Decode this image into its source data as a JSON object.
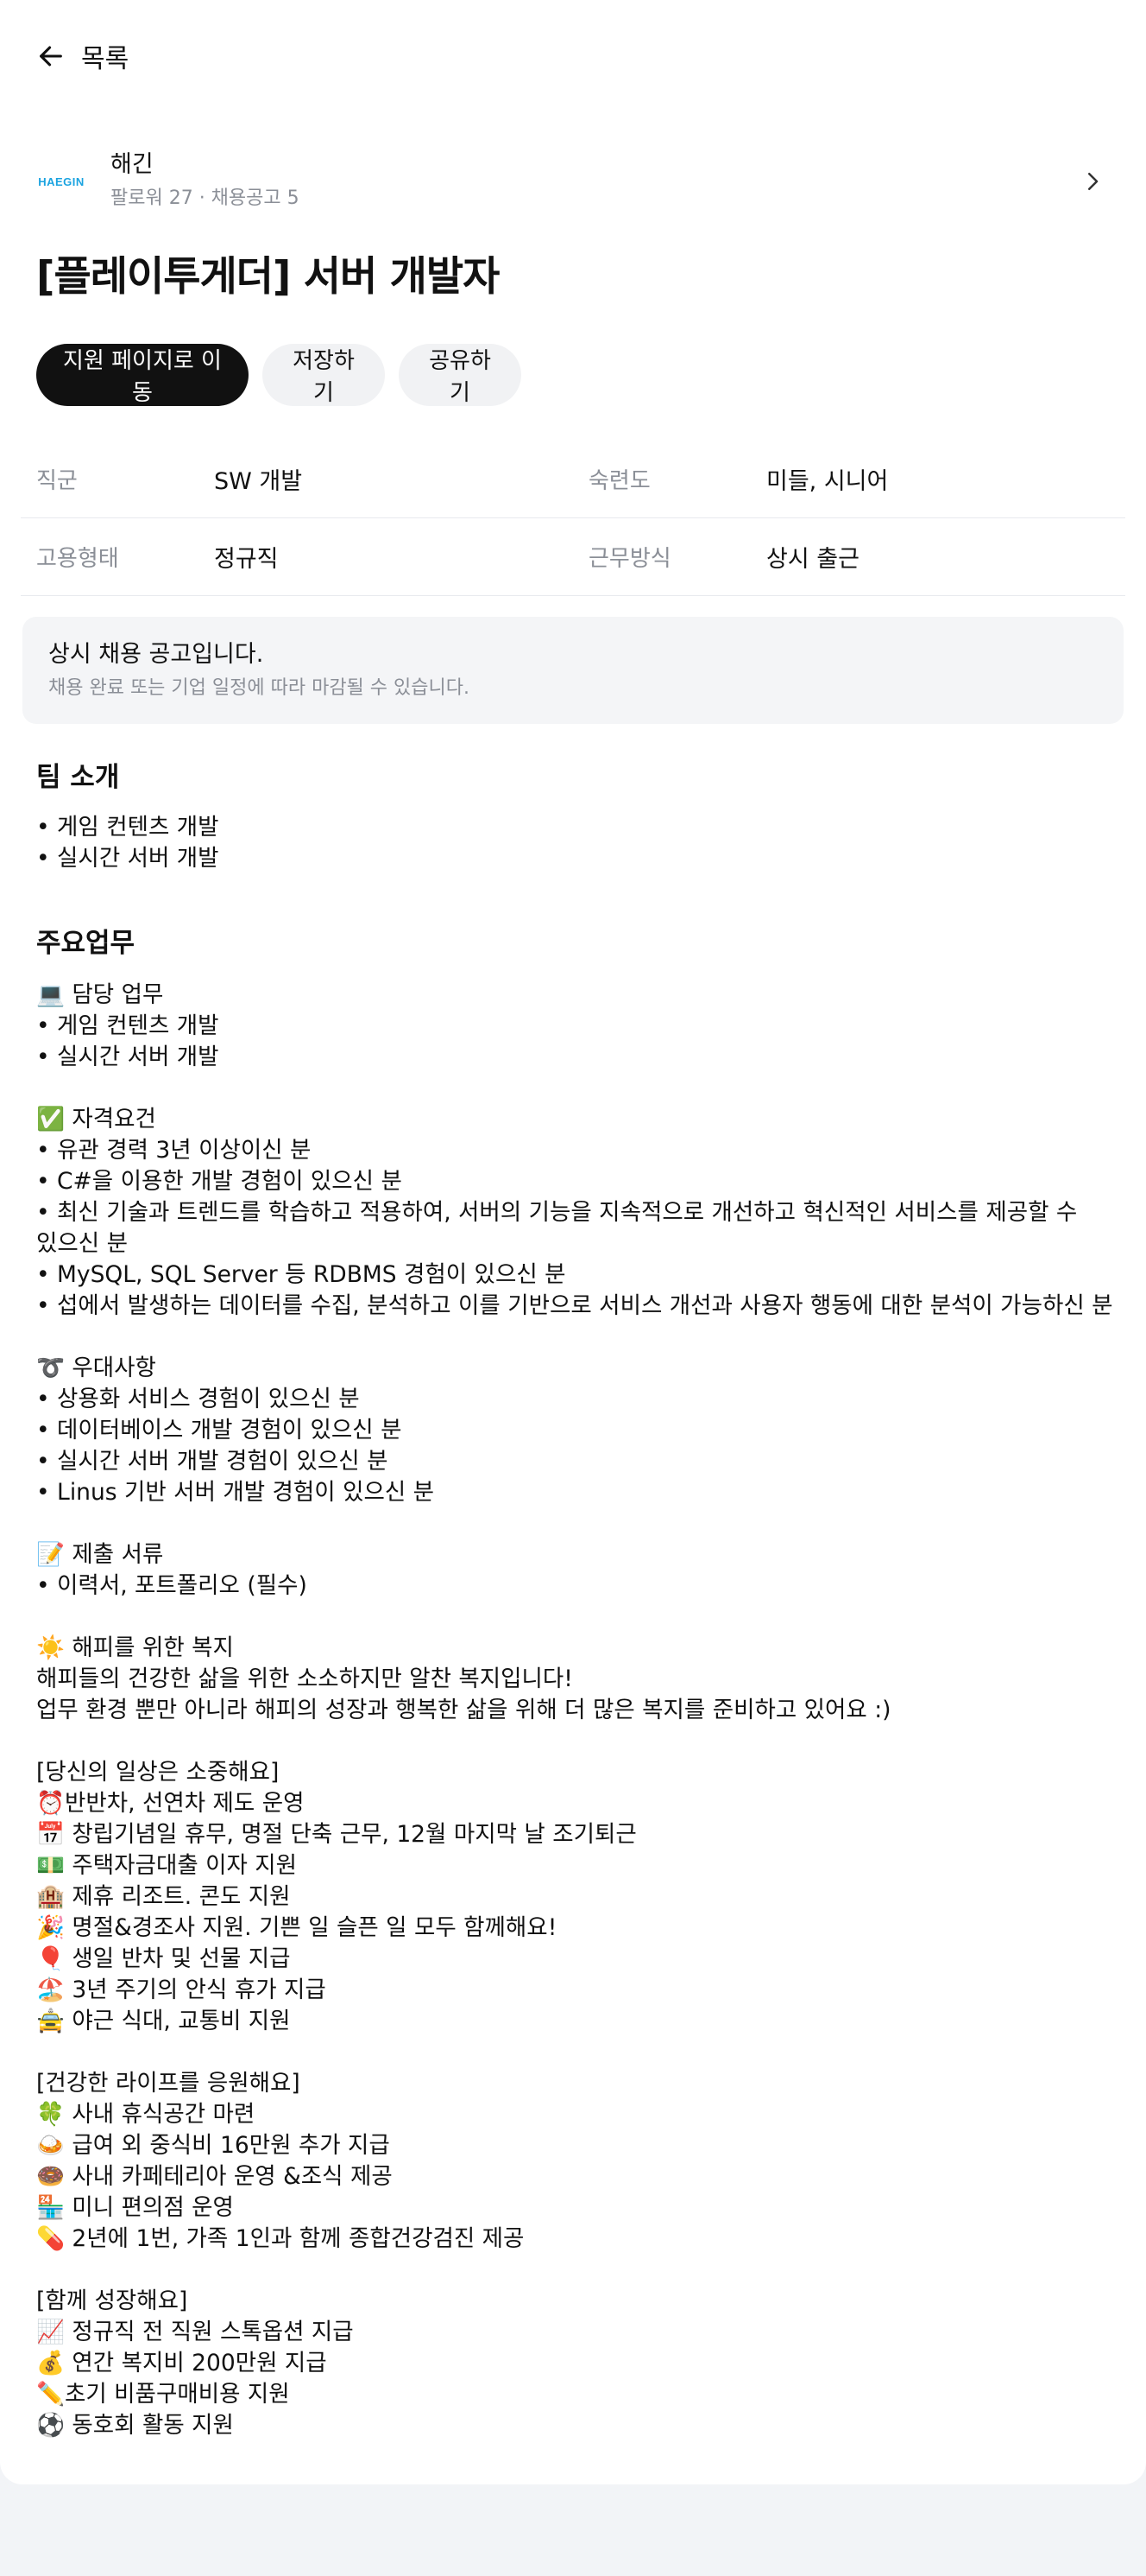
{
  "nav": {
    "back_label": "목록"
  },
  "company": {
    "logo_text": "HAEGIN",
    "name": "해긴",
    "meta": "팔로워 27 · 채용공고 5"
  },
  "job": {
    "title": "[플레이투게더] 서버 개발자"
  },
  "actions": {
    "apply": "지원 페이지로 이동",
    "save": "저장하기",
    "share": "공유하기"
  },
  "info": [
    {
      "label": "직군",
      "value": "SW 개발",
      "label2": "숙련도",
      "value2": "미들, 시니어"
    },
    {
      "label": "고용형태",
      "value": "정규직",
      "label2": "근무방식",
      "value2": "상시 출근"
    }
  ],
  "notice": {
    "title": "상시 채용 공고입니다.",
    "subtitle": "채용 완료 또는 기업 일정에 따라 마감될 수 있습니다."
  },
  "team": {
    "heading": "팀 소개",
    "lines": [
      "• 게임 컨텐츠 개발",
      "• 실시간 서버 개발"
    ]
  },
  "duties": {
    "heading": "주요업무",
    "lines": [
      "💻 담당 업무",
      "• 게임 컨텐츠 개발",
      "• 실시간 서버 개발",
      "",
      "✅ 자격요건",
      "• 유관 경력 3년 이상이신 분",
      "• C#을 이용한 개발 경험이 있으신 분",
      "• 최신 기술과 트렌드를 학습하고 적용하여, 서버의 기능을 지속적으로 개선하고 혁신적인 서비스를 제공할 수",
      "있으신 분",
      "• MySQL, SQL Server 등 RDBMS 경험이 있으신 분",
      "• 섭에서 발생하는 데이터를 수집, 분석하고 이를 기반으로 서비스 개선과 사용자 행동에 대한 분석이 가능하신 분",
      "",
      "➰ 우대사항",
      "• 상용화 서비스 경험이 있으신 분",
      "• 데이터베이스 개발 경험이 있으신 분",
      "• 실시간 서버 개발 경험이 있으신 분",
      "• Linus 기반 서버 개발 경험이 있으신 분",
      "",
      "📝 제출 서류",
      "• 이력서, 포트폴리오 (필수)",
      "",
      "☀️ 해피를 위한 복지",
      "해피들의 건강한 삶을 위한 소소하지만 알찬 복지입니다!",
      "업무 환경 뿐만 아니라 해피의 성장과 행복한 삶을 위해 더 많은 복지를 준비하고 있어요 :)",
      "",
      "[당신의 일상은 소중해요]",
      "⏰반반차, 선연차 제도 운영",
      "📅 창립기념일 휴무, 명절 단축 근무, 12월 마지막 날 조기퇴근",
      "💵 주택자금대출 이자 지원",
      "🏨 제휴 리조트. 콘도 지원",
      "🎉 명절&경조사 지원. 기쁜 일 슬픈 일 모두 함께해요!",
      "🎈 생일 반차 및 선물 지급",
      "🏖️ 3년 주기의 안식 휴가 지급",
      "🚖 야근 식대, 교통비 지원",
      "",
      "[건강한 라이프를 응원해요]",
      "🍀 사내 휴식공간 마련",
      "🍛 급여 외 중식비 16만원 추가 지급",
      "🍩 사내 카페테리아 운영 &조식 제공",
      "🏪 미니 편의점 운영",
      "💊 2년에 1번, 가족 1인과 함께 종합건강검진 제공",
      "",
      "[함께 성장해요]",
      "📈 정규직 전 직원 스톡옵션 지급",
      "💰 연간 복지비 200만원 지급",
      "✏️초기 비품구매비용 지원",
      "⚽ 동호회 활동 지원"
    ]
  },
  "colors": {
    "page_bg": "#f2f4f7",
    "card_bg": "#ffffff",
    "primary_button": "#111111",
    "secondary_button": "#f1f2f4",
    "muted_text": "#8b8f97",
    "logo_blue": "#1aa3e0"
  },
  "icons": {
    "back": "arrow-left-icon",
    "company_chevron": "chevron-right-icon"
  }
}
